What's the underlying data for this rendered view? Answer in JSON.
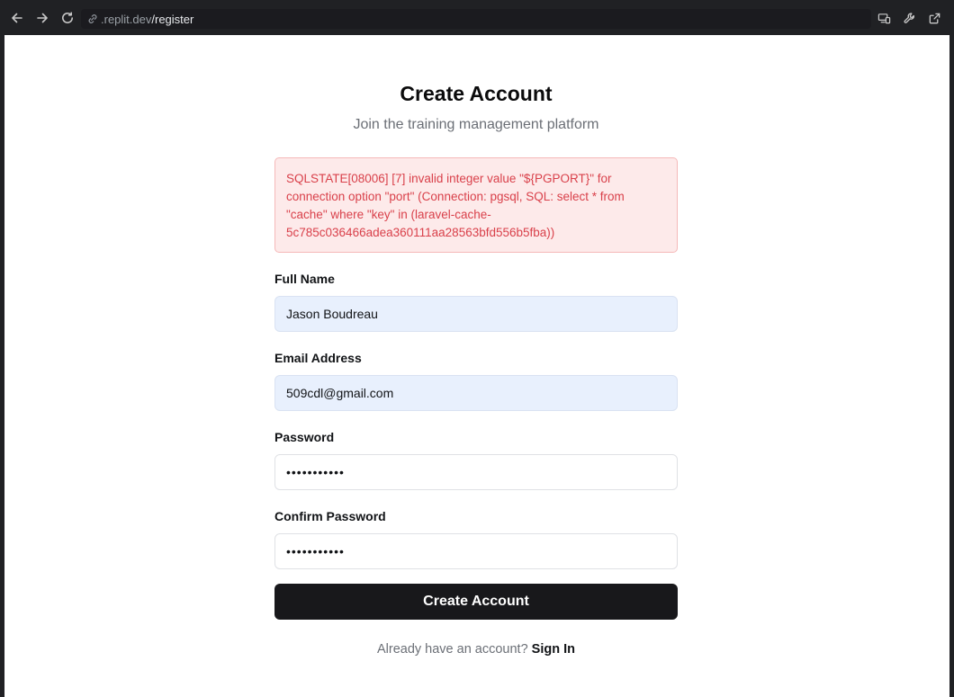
{
  "browser": {
    "url_host": ".replit.dev",
    "url_path": "/register"
  },
  "page": {
    "title": "Create Account",
    "subtitle": "Join the training management platform",
    "error_message": "SQLSTATE[08006] [7] invalid integer value \"${PGPORT}\" for connection option \"port\" (Connection: pgsql, SQL: select * from \"cache\" where \"key\" in (laravel-cache-5c785c036466adea360111aa28563bfd556b5fba))"
  },
  "form": {
    "full_name": {
      "label": "Full Name",
      "value": "Jason Boudreau"
    },
    "email": {
      "label": "Email Address",
      "value": "509cdl@gmail.com"
    },
    "password": {
      "label": "Password",
      "value": "•••••••••••"
    },
    "confirm_password": {
      "label": "Confirm Password",
      "value": "•••••••••••"
    },
    "submit_label": "Create Account"
  },
  "footer": {
    "prompt": "Already have an account?",
    "link_label": "Sign In"
  },
  "colors": {
    "error_text": "#d9404a",
    "error_bg": "#fdeaea",
    "button_bg": "#18181b",
    "autofill_bg": "#e8f0fd"
  },
  "icons": [
    "back-arrow-icon",
    "forward-arrow-icon",
    "reload-icon",
    "link-icon",
    "devices-icon",
    "wrench-icon",
    "open-external-icon"
  ]
}
